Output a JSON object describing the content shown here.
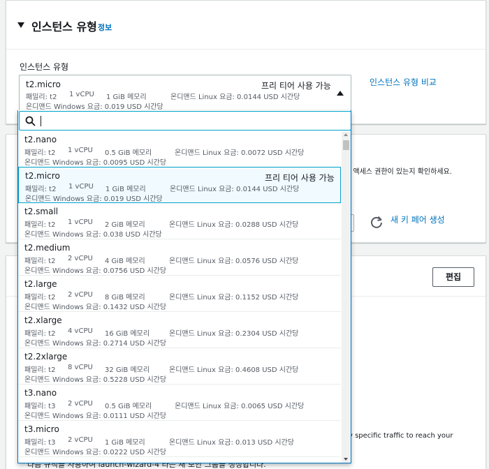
{
  "section": {
    "title": "인스턴스 유형",
    "info_link": "정보",
    "field_label": "인스턴스 유형",
    "compare_link": "인스턴스 유형 비교"
  },
  "selected": {
    "name": "t2.micro",
    "free_tier": "프리 티어 사용 가능",
    "family": "패밀리: t2",
    "vcpu": "1 vCPU",
    "memory": "1 GiB 메모리",
    "linux_price": "온디맨드 Linux 요금: 0.0144 USD 시간당",
    "windows_price": "온디맨드 Windows 요금: 0.019 USD 시간당"
  },
  "search": {
    "value": ""
  },
  "instance_options": [
    {
      "name": "t2.nano",
      "free_tier": "",
      "family": "패밀리: t2",
      "vcpu": "1 vCPU",
      "memory": "0.5 GiB 메모리",
      "linux_price": "온디맨드 Linux 요금: 0.0072 USD 시간당",
      "windows_price": "온디맨드 Windows 요금: 0.0095 USD 시간당"
    },
    {
      "name": "t2.micro",
      "free_tier": "프리 티어 사용 가능",
      "family": "패밀리: t2",
      "vcpu": "1 vCPU",
      "memory": "1 GiB 메모리",
      "linux_price": "온디맨드 Linux 요금: 0.0144 USD 시간당",
      "windows_price": "온디맨드 Windows 요금: 0.019 USD 시간당"
    },
    {
      "name": "t2.small",
      "free_tier": "",
      "family": "패밀리: t2",
      "vcpu": "1 vCPU",
      "memory": "2 GiB 메모리",
      "linux_price": "온디맨드 Linux 요금: 0.0288 USD 시간당",
      "windows_price": "온디맨드 Windows 요금: 0.038 USD 시간당"
    },
    {
      "name": "t2.medium",
      "free_tier": "",
      "family": "패밀리: t2",
      "vcpu": "2 vCPU",
      "memory": "4 GiB 메모리",
      "linux_price": "온디맨드 Linux 요금: 0.0576 USD 시간당",
      "windows_price": "온디맨드 Windows 요금: 0.0756 USD 시간당"
    },
    {
      "name": "t2.large",
      "free_tier": "",
      "family": "패밀리: t2",
      "vcpu": "2 vCPU",
      "memory": "8 GiB 메모리",
      "linux_price": "온디맨드 Linux 요금: 0.1152 USD 시간당",
      "windows_price": "온디맨드 Windows 요금: 0.1432 USD 시간당"
    },
    {
      "name": "t2.xlarge",
      "free_tier": "",
      "family": "패밀리: t2",
      "vcpu": "4 vCPU",
      "memory": "16 GiB 메모리",
      "linux_price": "온디맨드 Linux 요금: 0.2304 USD 시간당",
      "windows_price": "온디맨드 Windows 요금: 0.2714 USD 시간당"
    },
    {
      "name": "t2.2xlarge",
      "free_tier": "",
      "family": "패밀리: t2",
      "vcpu": "8 vCPU",
      "memory": "32 GiB 메모리",
      "linux_price": "온디맨드 Linux 요금: 0.4608 USD 시간당",
      "windows_price": "온디맨드 Windows 요금: 0.5228 USD 시간당"
    },
    {
      "name": "t3.nano",
      "free_tier": "",
      "family": "패밀리: t3",
      "vcpu": "2 vCPU",
      "memory": "0.5 GiB 메모리",
      "linux_price": "온디맨드 Linux 요금: 0.0065 USD 시간당",
      "windows_price": "온디맨드 Windows 요금: 0.0111 USD 시간당"
    },
    {
      "name": "t3.micro",
      "free_tier": "",
      "family": "패밀리: t3",
      "vcpu": "2 vCPU",
      "memory": "1 GiB 메모리",
      "linux_price": "온디맨드 Linux 요금: 0.013 USD 시간당",
      "windows_price": "온디맨드 Windows 요금: 0.0222 USD 시간당"
    }
  ],
  "keypair": {
    "description_fragment": "한 액세스 권한이 있는지 확인하세요.",
    "create_link": "새 키 페어 생성"
  },
  "network": {
    "edit_button": "편집",
    "description_fragment": "y specific traffic to reach your",
    "bottom_fragment": "다음 규칙을 사용하여 launch-wizard-4 라는 새 보안 그룹을 생성합니다."
  },
  "colors": {
    "link": "#0073bb",
    "focus": "#00a1c9",
    "selected_bg": "#f1faff"
  }
}
